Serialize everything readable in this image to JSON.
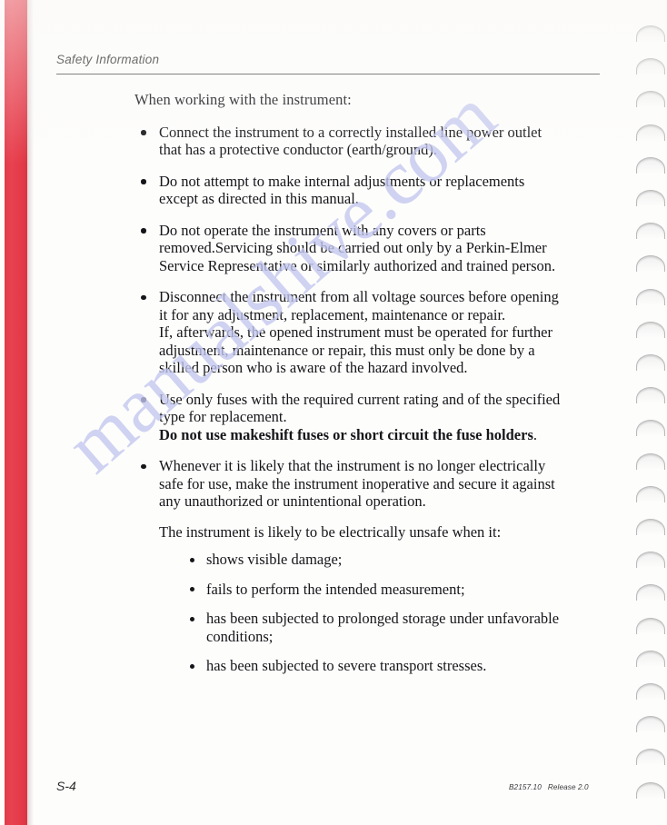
{
  "header": {
    "title": "Safety Information"
  },
  "body": {
    "intro": "When working with the instrument:",
    "bullets": [
      {
        "lines": [
          "Connect the instrument to a correctly installed line power outlet",
          "that has a protective conductor (earth/ground)."
        ]
      },
      {
        "lines": [
          "Do not attempt to make internal adjustments or replacements",
          "except as directed in this manual."
        ]
      },
      {
        "lines": [
          "Do not operate the instrument with any covers or parts",
          "removed.Servicing should be carried out only by a Perkin-Elmer",
          "Service Representative or similarly authorized and trained person."
        ]
      },
      {
        "lines": [
          "Disconnect the instrument from all voltage sources before opening",
          "it for any adjustment, replacement, maintenance or repair.",
          "If, afterwards, the opened instrument must be operated for further",
          "adjustment, maintenance or repair, this must only be done by a",
          "skilled person who is aware of the hazard involved."
        ]
      },
      {
        "lines": [
          "Use only fuses with the required current rating and of the specified",
          "type for replacement."
        ],
        "bold_line": "Do not use makeshift fuses or short circuit the fuse holders",
        "bold_line_suffix": "."
      },
      {
        "lines": [
          "Whenever it is likely that the instrument is no longer electrically",
          "safe for use, make the instrument inoperative and secure it against",
          "any unauthorized or unintentional operation."
        ],
        "sub_intro": "The instrument is likely to be electrically unsafe when it:",
        "sub_bullets": [
          {
            "lines": [
              "shows visible damage;"
            ]
          },
          {
            "lines": [
              "fails to perform the intended measurement;"
            ]
          },
          {
            "lines": [
              "has been subjected to prolonged storage under unfavorable",
              "conditions;"
            ]
          },
          {
            "lines": [
              "has been subjected to severe transport stresses."
            ]
          }
        ]
      }
    ]
  },
  "footer": {
    "page_number": "S-4",
    "doc_number": "B2157.10",
    "release": "Release 2.0"
  },
  "watermark": {
    "text": "manualshive.com"
  },
  "colors": {
    "spine_red": "#e53a49",
    "watermark_blue": "#c3c6ee",
    "text": "#16161a"
  }
}
